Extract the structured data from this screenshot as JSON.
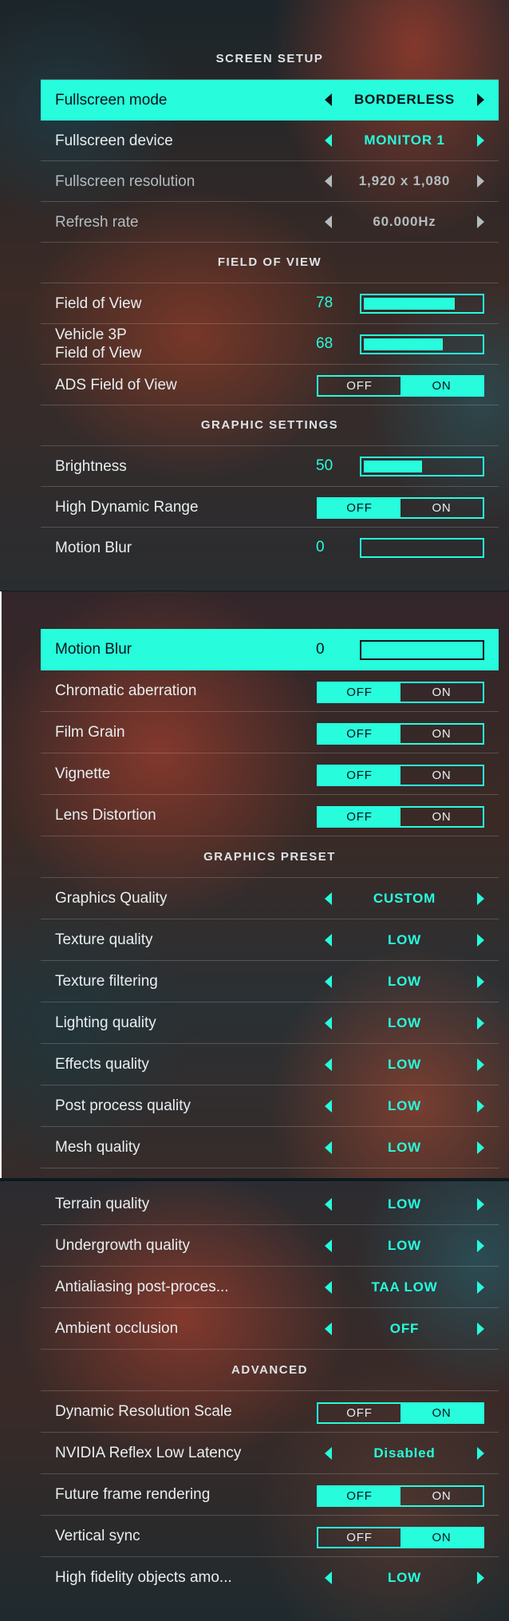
{
  "colors": {
    "accent": "#27fcdc",
    "text": "#e8eef0",
    "dark_text": "#0b1416"
  },
  "panel1": {
    "sections": {
      "screen_setup": "SCREEN SETUP",
      "field_of_view": "FIELD OF VIEW",
      "graphic_settings": "GRAPHIC SETTINGS"
    },
    "fullscreen_mode": {
      "label": "Fullscreen mode",
      "value": "BORDERLESS"
    },
    "fullscreen_device": {
      "label": "Fullscreen device",
      "value": "MONITOR 1"
    },
    "fullscreen_resolution": {
      "label": "Fullscreen resolution",
      "value": "1,920 x 1,080"
    },
    "refresh_rate": {
      "label": "Refresh rate",
      "value": "60.000Hz"
    },
    "field_of_view": {
      "label": "Field of View",
      "value": "78",
      "fill_percent": 78
    },
    "vehicle_fov": {
      "label_line1": "Vehicle 3P",
      "label_line2": "Field of View",
      "value": "68",
      "fill_percent": 68
    },
    "ads_fov": {
      "label": "ADS Field of View",
      "off": "OFF",
      "on": "ON",
      "state": "on"
    },
    "brightness": {
      "label": "Brightness",
      "value": "50",
      "fill_percent": 50
    },
    "hdr": {
      "label": "High Dynamic Range",
      "off": "OFF",
      "on": "ON",
      "state": "off"
    },
    "motion_blur": {
      "label": "Motion Blur",
      "value": "0",
      "fill_percent": 0
    }
  },
  "panel2": {
    "motion_blur": {
      "label": "Motion Blur",
      "value": "0",
      "fill_percent": 0
    },
    "chromatic_aberration": {
      "label": "Chromatic aberration",
      "off": "OFF",
      "on": "ON",
      "state": "off"
    },
    "film_grain": {
      "label": "Film Grain",
      "off": "OFF",
      "on": "ON",
      "state": "off"
    },
    "vignette": {
      "label": "Vignette",
      "off": "OFF",
      "on": "ON",
      "state": "off"
    },
    "lens_distortion": {
      "label": "Lens Distortion",
      "off": "OFF",
      "on": "ON",
      "state": "off"
    },
    "sections": {
      "graphics_preset": "GRAPHICS PRESET"
    },
    "graphics_quality": {
      "label": "Graphics Quality",
      "value": "CUSTOM"
    },
    "texture_quality": {
      "label": "Texture quality",
      "value": "LOW"
    },
    "texture_filtering": {
      "label": "Texture filtering",
      "value": "LOW"
    },
    "lighting_quality": {
      "label": "Lighting quality",
      "value": "LOW"
    },
    "effects_quality": {
      "label": "Effects quality",
      "value": "LOW"
    },
    "post_process_quality": {
      "label": "Post process quality",
      "value": "LOW"
    },
    "mesh_quality": {
      "label": "Mesh quality",
      "value": "LOW"
    }
  },
  "panel3": {
    "terrain_quality": {
      "label": "Terrain quality",
      "value": "LOW"
    },
    "undergrowth_quality": {
      "label": "Undergrowth quality",
      "value": "LOW"
    },
    "antialiasing": {
      "label": "Antialiasing post-proces...",
      "value": "TAA LOW"
    },
    "ambient_occlusion": {
      "label": "Ambient occlusion",
      "value": "OFF"
    },
    "sections": {
      "advanced": "ADVANCED"
    },
    "dynamic_resolution_scale": {
      "label": "Dynamic Resolution Scale",
      "off": "OFF",
      "on": "ON",
      "state": "on"
    },
    "nvidia_reflex": {
      "label": "NVIDIA Reflex Low Latency",
      "value": "Disabled"
    },
    "future_frame_rendering": {
      "label": "Future frame rendering",
      "off": "OFF",
      "on": "ON",
      "state": "off"
    },
    "vertical_sync": {
      "label": "Vertical sync",
      "off": "OFF",
      "on": "ON",
      "state": "on"
    },
    "high_fidelity_objects": {
      "label": "High fidelity objects amo...",
      "value": "LOW"
    }
  }
}
